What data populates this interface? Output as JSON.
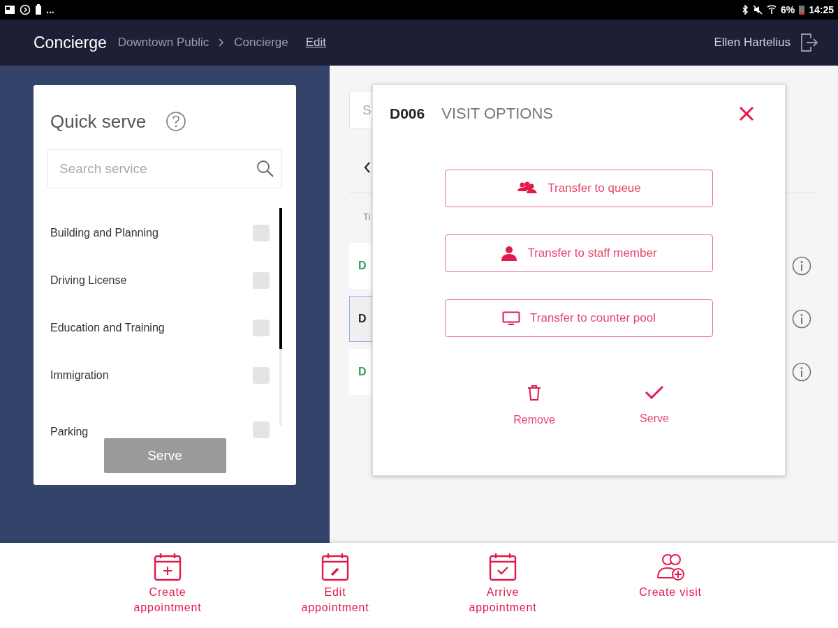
{
  "status_bar": {
    "more": "...",
    "battery": "6%",
    "time": "14:25"
  },
  "header": {
    "title": "Concierge",
    "breadcrumb": [
      "Downtown Public",
      "Concierge"
    ],
    "edit_link": "Edit",
    "user": "Ellen Hartelius"
  },
  "quick_serve": {
    "title": "Quick serve",
    "search": {
      "placeholder": "Search service"
    },
    "services": [
      {
        "label": "Building and Planning",
        "checked": false
      },
      {
        "label": "Driving License",
        "checked": false
      },
      {
        "label": "Education and Training",
        "checked": false
      },
      {
        "label": "Immigration",
        "checked": false
      },
      {
        "label": "Parking",
        "checked": false
      }
    ],
    "serve_button": "Serve"
  },
  "visit_list": {
    "search_text": "S",
    "column_header": "Ti",
    "rows": [
      {
        "code": "D",
        "selected": false,
        "color": "#2e9e5e"
      },
      {
        "code": "D",
        "selected": true,
        "color": "#222222"
      },
      {
        "code": "D",
        "selected": false,
        "color": "#2e9e5e"
      }
    ]
  },
  "modal": {
    "ticket": "D006",
    "title": "VISIT OPTIONS",
    "transfer_buttons": [
      {
        "kind": "queue",
        "label": "Transfer to queue"
      },
      {
        "kind": "staff",
        "label": "Transfer to staff member"
      },
      {
        "kind": "counter",
        "label": "Transfer to counter pool"
      }
    ],
    "actions": [
      {
        "kind": "remove",
        "label": "Remove"
      },
      {
        "kind": "serve",
        "label": "Serve"
      }
    ]
  },
  "bottom_nav": [
    {
      "kind": "create",
      "label": "Create appointment"
    },
    {
      "kind": "edit",
      "label": "Edit appointment"
    },
    {
      "kind": "arrive",
      "label": "Arrive appointment"
    },
    {
      "kind": "visit",
      "label": "Create visit"
    }
  ]
}
